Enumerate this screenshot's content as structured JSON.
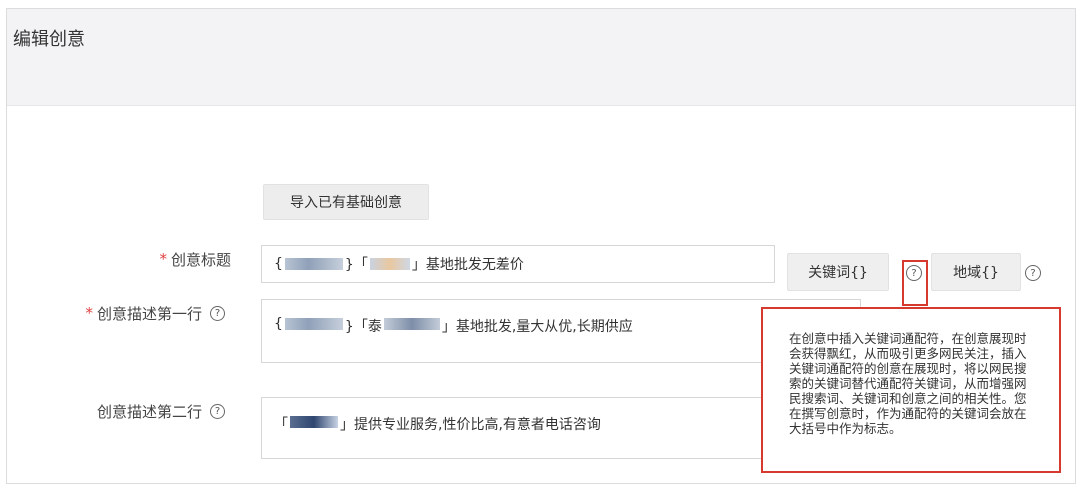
{
  "panel": {
    "title": "编辑创意"
  },
  "import_button": "导入已有基础创意",
  "fields": {
    "title": {
      "required_mark": "*",
      "label": "创意标题",
      "value_prefix": "{",
      "value_mid": "}「",
      "value_text": "」基地批发无差价"
    },
    "desc1": {
      "required_mark": "*",
      "label": "创意描述第一行",
      "value_prefix": "{",
      "value_mid": "}「泰",
      "value_text": "」基地批发,量大从优,长期供应"
    },
    "desc2": {
      "label": "创意描述第二行",
      "value_prefix": "「",
      "value_text": "」提供专业服务,性价比高,有意者电话咨询"
    }
  },
  "insert_buttons": {
    "keyword": "关键词{}",
    "region": "地域{}"
  },
  "help_glyph": "?",
  "tooltip_text": "在创意中插入关键词通配符，在创意展现时会获得飘红，从而吸引更多网民关注，插入关键词通配符的创意在展现时，将以网民搜索的关键词替代通配符关键词，从而增强网民搜索词、关键词和创意之间的相关性。您在撰写创意时，作为通配符的关键词会放在大括号中作为标志。",
  "colors": {
    "highlight": "#d63a2e",
    "required": "#e04040"
  }
}
